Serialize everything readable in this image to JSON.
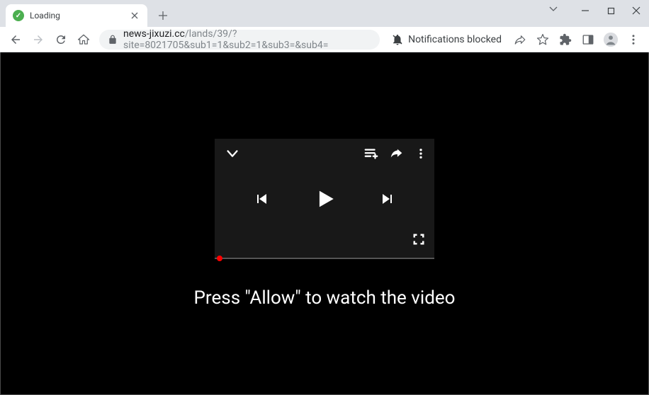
{
  "titlebar": {
    "tab_title": "Loading"
  },
  "addressbar": {
    "url_domain": "news-jixuzi.cc",
    "url_path": "/lands/39/?site=8021705&sub1=1&sub2=1&sub3=&sub4=",
    "notification_status": "Notifications blocked"
  },
  "page": {
    "instruction_text": "Press \"Allow\" to watch the video"
  }
}
